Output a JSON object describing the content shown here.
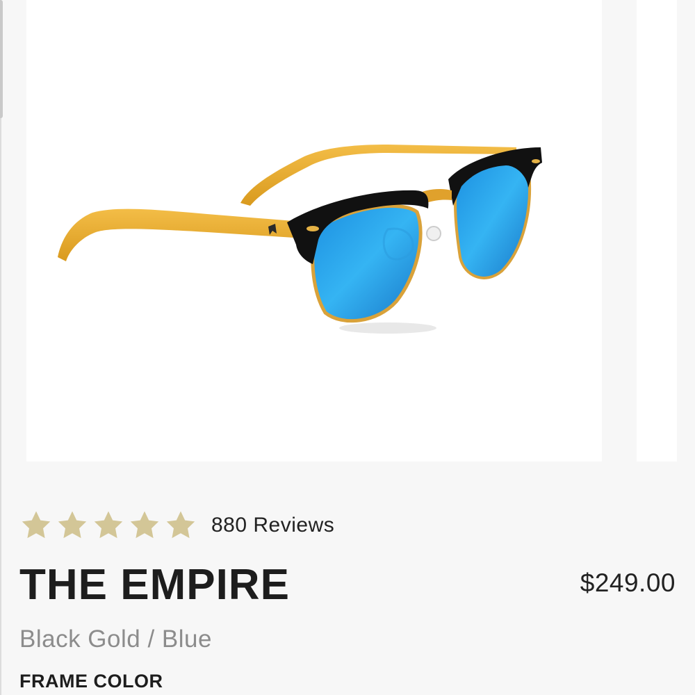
{
  "product": {
    "image_alt": "Sunglasses with black and gold frame and blue mirrored lenses",
    "rating": {
      "stars": 5,
      "max_stars": 5,
      "star_color": "#d3c697",
      "reviews_label": "880 Reviews"
    },
    "name": "THE EMPIRE",
    "price": "$249.00",
    "variant": "Black Gold / Blue",
    "option_label": "FRAME COLOR"
  },
  "icons": {
    "star": "star-icon"
  }
}
